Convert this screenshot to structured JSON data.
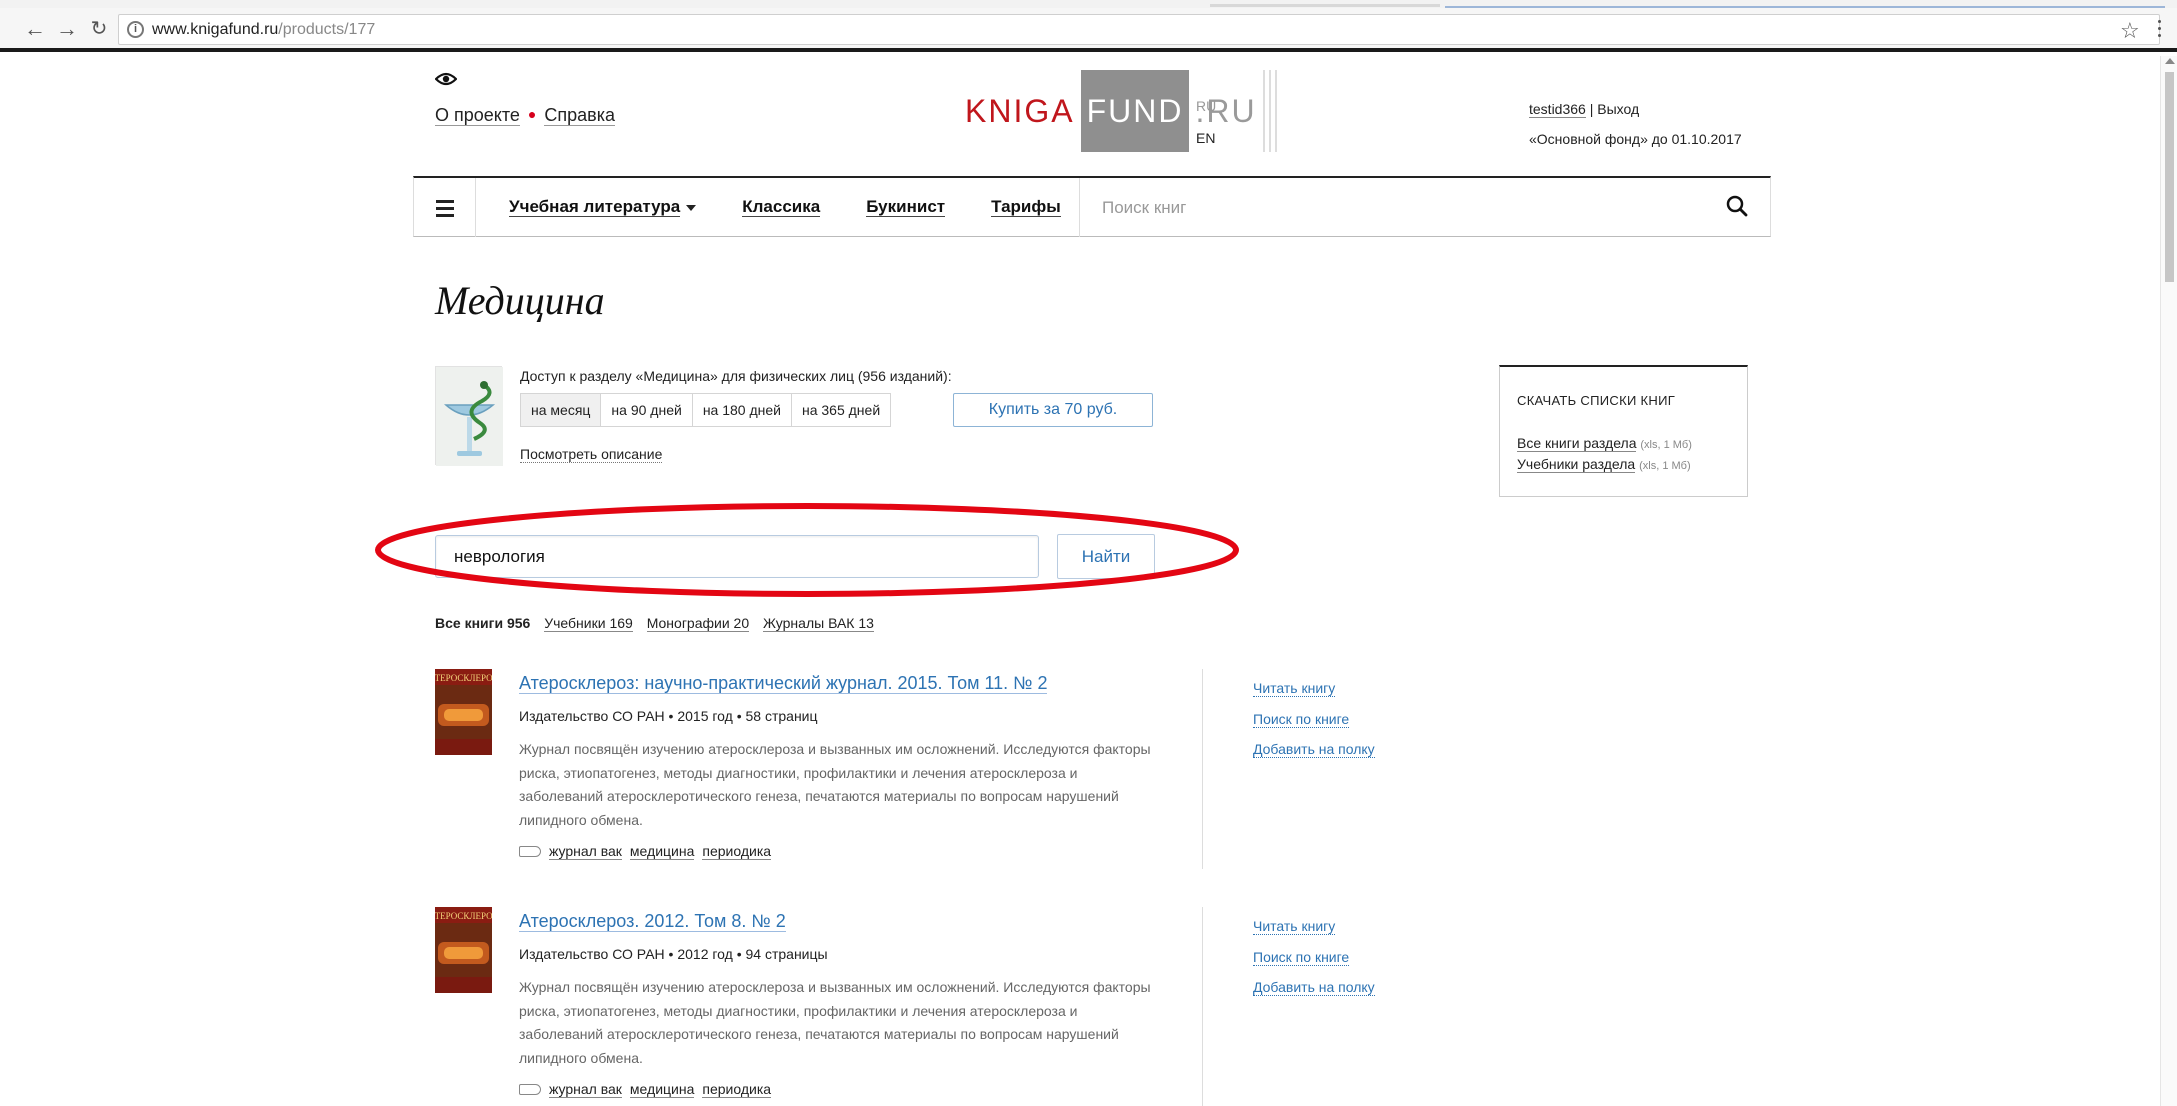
{
  "browser": {
    "url_host": "www.knigafund.ru",
    "url_path": "/products/177"
  },
  "header": {
    "about_label": "О проекте",
    "help_label": "Справка",
    "logo": {
      "part1": "KNIGA",
      "part2": "FUND",
      "part3": ".RU"
    },
    "lang_ru": "RU",
    "lang_en": "EN",
    "username": "testid366",
    "logout_label": "| Выход",
    "subscription": "«Основной фонд» до 01.10.2017"
  },
  "nav": {
    "items": [
      "Учебная литература",
      "Классика",
      "Букинист",
      "Тарифы"
    ],
    "search_placeholder": "Поиск книг"
  },
  "page": {
    "title": "Медицина",
    "access_text": "Доступ к разделу «Медицина» для физических лиц (956 изданий):",
    "durations": [
      "на месяц",
      "на 90 дней",
      "на 180 дней",
      "на 365 дней"
    ],
    "selected_duration": "на месяц",
    "buy_label": "Купить за 70 руб.",
    "view_description": "Посмотреть описание"
  },
  "downloads": {
    "title": "СКАЧАТЬ СПИСКИ КНИГ",
    "links": [
      {
        "label": "Все книги раздела",
        "meta": "(xls, 1 Мб)"
      },
      {
        "label": "Учебники раздела",
        "meta": "(xls, 1 Мб)"
      }
    ]
  },
  "search": {
    "value": "неврология",
    "button_label": "Найти"
  },
  "filters": {
    "all": "Все книги 956",
    "items": [
      "Учебники 169",
      "Монографии 20",
      "Журналы ВАК 13"
    ]
  },
  "books": [
    {
      "title": "Атеросклероз: научно-практический журнал. 2015. Том 11. № 2",
      "meta": "Издательство СО РАН • 2015 год • 58 страниц",
      "description": "Журнал посвящён изучению атеросклероза и вызванных им осложнений. Исследуются факторы риска, этиопатогенез, методы диагностики, профилактики и лечения атеросклероза и заболеваний атеросклеротического генеза, печатаются материалы по вопросам нарушений липидного обмена.",
      "tags": [
        "журнал вак",
        "медицина",
        "периодика"
      ],
      "actions": [
        "Читать книгу",
        "Поиск по книге",
        "Добавить на полку"
      ]
    },
    {
      "title": "Атеросклероз. 2012. Том 8. № 2",
      "meta": "Издательство СО РАН • 2012 год • 94 страницы",
      "description": "Журнал посвящён изучению атеросклероза и вызванных им осложнений. Исследуются факторы риска, этиопатогенез, методы диагностики, профилактики и лечения атеросклероза и заболеваний атеросклеротического генеза, печатаются материалы по вопросам нарушений липидного обмена.",
      "tags": [
        "журнал вак",
        "медицина",
        "периодика"
      ],
      "actions": [
        "Читать книгу",
        "Поиск по книге",
        "Добавить на полку"
      ]
    }
  ],
  "colors": {
    "logo_red": "#c0161c",
    "link_blue": "#2d73b3",
    "highlight_red": "#e30613"
  }
}
